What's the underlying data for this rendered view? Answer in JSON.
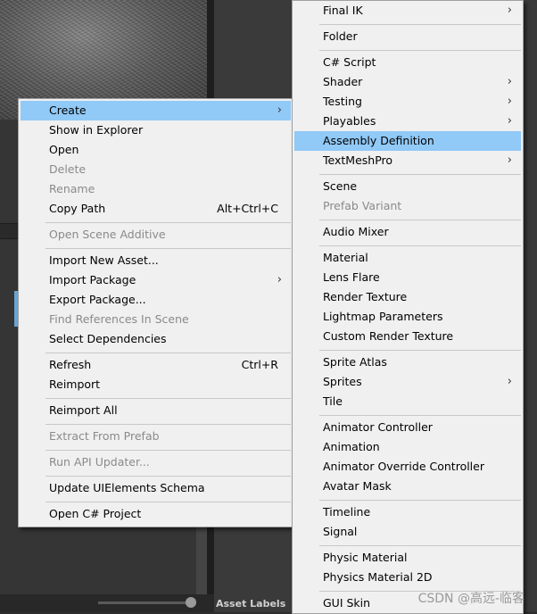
{
  "background": {
    "panel_label": "Asset Labels"
  },
  "context_menu": {
    "items": [
      {
        "label": "Create",
        "shortcut": "",
        "submenu": true,
        "disabled": false,
        "selected": true
      },
      {
        "label": "Show in Explorer",
        "shortcut": "",
        "submenu": false,
        "disabled": false,
        "selected": false
      },
      {
        "label": "Open",
        "shortcut": "",
        "submenu": false,
        "disabled": false,
        "selected": false
      },
      {
        "label": "Delete",
        "shortcut": "",
        "submenu": false,
        "disabled": true,
        "selected": false
      },
      {
        "label": "Rename",
        "shortcut": "",
        "submenu": false,
        "disabled": true,
        "selected": false
      },
      {
        "label": "Copy Path",
        "shortcut": "Alt+Ctrl+C",
        "submenu": false,
        "disabled": false,
        "selected": false
      },
      {
        "label": "Open Scene Additive",
        "shortcut": "",
        "submenu": false,
        "disabled": true,
        "selected": false
      },
      {
        "label": "Import New Asset...",
        "shortcut": "",
        "submenu": false,
        "disabled": false,
        "selected": false
      },
      {
        "label": "Import Package",
        "shortcut": "",
        "submenu": true,
        "disabled": false,
        "selected": false
      },
      {
        "label": "Export Package...",
        "shortcut": "",
        "submenu": false,
        "disabled": false,
        "selected": false
      },
      {
        "label": "Find References In Scene",
        "shortcut": "",
        "submenu": false,
        "disabled": true,
        "selected": false
      },
      {
        "label": "Select Dependencies",
        "shortcut": "",
        "submenu": false,
        "disabled": false,
        "selected": false
      },
      {
        "label": "Refresh",
        "shortcut": "Ctrl+R",
        "submenu": false,
        "disabled": false,
        "selected": false
      },
      {
        "label": "Reimport",
        "shortcut": "",
        "submenu": false,
        "disabled": false,
        "selected": false
      },
      {
        "label": "Reimport All",
        "shortcut": "",
        "submenu": false,
        "disabled": false,
        "selected": false
      },
      {
        "label": "Extract From Prefab",
        "shortcut": "",
        "submenu": false,
        "disabled": true,
        "selected": false
      },
      {
        "label": "Run API Updater...",
        "shortcut": "",
        "submenu": false,
        "disabled": true,
        "selected": false
      },
      {
        "label": "Update UIElements Schema",
        "shortcut": "",
        "submenu": false,
        "disabled": false,
        "selected": false
      },
      {
        "label": "Open C# Project",
        "shortcut": "",
        "submenu": false,
        "disabled": false,
        "selected": false
      }
    ]
  },
  "create_submenu": {
    "items": [
      {
        "label": "Final IK",
        "submenu": true,
        "disabled": false,
        "selected": false
      },
      {
        "label": "Folder",
        "submenu": false,
        "disabled": false,
        "selected": false
      },
      {
        "label": "C# Script",
        "submenu": false,
        "disabled": false,
        "selected": false
      },
      {
        "label": "Shader",
        "submenu": true,
        "disabled": false,
        "selected": false
      },
      {
        "label": "Testing",
        "submenu": true,
        "disabled": false,
        "selected": false
      },
      {
        "label": "Playables",
        "submenu": true,
        "disabled": false,
        "selected": false
      },
      {
        "label": "Assembly Definition",
        "submenu": false,
        "disabled": false,
        "selected": true
      },
      {
        "label": "TextMeshPro",
        "submenu": true,
        "disabled": false,
        "selected": false
      },
      {
        "label": "Scene",
        "submenu": false,
        "disabled": false,
        "selected": false
      },
      {
        "label": "Prefab Variant",
        "submenu": false,
        "disabled": true,
        "selected": false
      },
      {
        "label": "Audio Mixer",
        "submenu": false,
        "disabled": false,
        "selected": false
      },
      {
        "label": "Material",
        "submenu": false,
        "disabled": false,
        "selected": false
      },
      {
        "label": "Lens Flare",
        "submenu": false,
        "disabled": false,
        "selected": false
      },
      {
        "label": "Render Texture",
        "submenu": false,
        "disabled": false,
        "selected": false
      },
      {
        "label": "Lightmap Parameters",
        "submenu": false,
        "disabled": false,
        "selected": false
      },
      {
        "label": "Custom Render Texture",
        "submenu": false,
        "disabled": false,
        "selected": false
      },
      {
        "label": "Sprite Atlas",
        "submenu": false,
        "disabled": false,
        "selected": false
      },
      {
        "label": "Sprites",
        "submenu": true,
        "disabled": false,
        "selected": false
      },
      {
        "label": "Tile",
        "submenu": false,
        "disabled": false,
        "selected": false
      },
      {
        "label": "Animator Controller",
        "submenu": false,
        "disabled": false,
        "selected": false
      },
      {
        "label": "Animation",
        "submenu": false,
        "disabled": false,
        "selected": false
      },
      {
        "label": "Animator Override Controller",
        "submenu": false,
        "disabled": false,
        "selected": false
      },
      {
        "label": "Avatar Mask",
        "submenu": false,
        "disabled": false,
        "selected": false
      },
      {
        "label": "Timeline",
        "submenu": false,
        "disabled": false,
        "selected": false
      },
      {
        "label": "Signal",
        "submenu": false,
        "disabled": false,
        "selected": false
      },
      {
        "label": "Physic Material",
        "submenu": false,
        "disabled": false,
        "selected": false
      },
      {
        "label": "Physics Material 2D",
        "submenu": false,
        "disabled": false,
        "selected": false
      },
      {
        "label": "GUI Skin",
        "submenu": false,
        "disabled": false,
        "selected": false
      }
    ]
  },
  "watermark": "CSDN @高远-临客",
  "colors": {
    "selection": "#91c9f7",
    "menu_bg": "#f0f0f0",
    "disabled_text": "#8a8a8a"
  }
}
